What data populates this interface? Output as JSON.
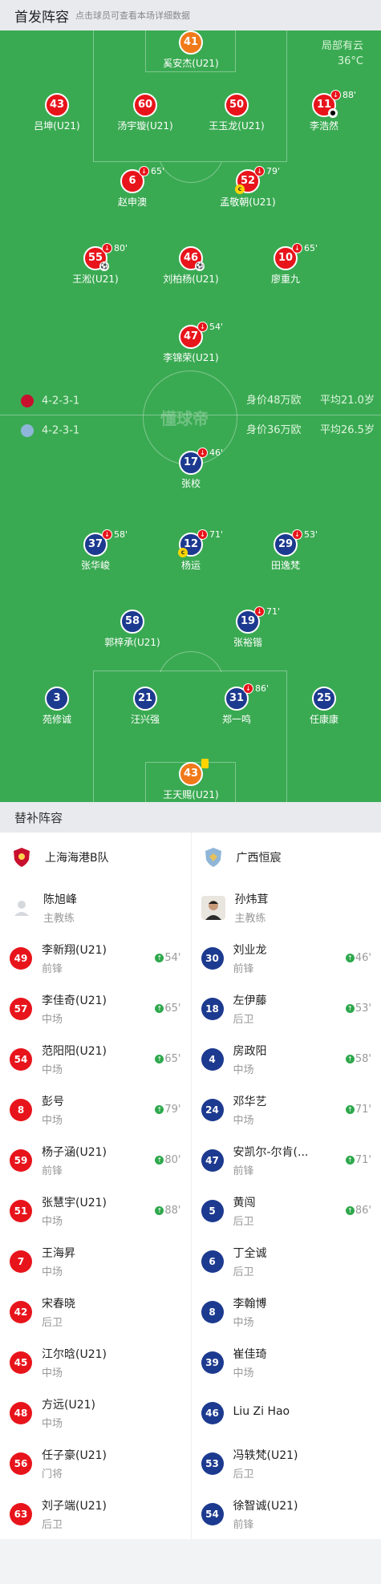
{
  "header": {
    "title": "首发阵容",
    "hint": "点击球员可查看本场详细数据"
  },
  "weather": {
    "line1": "局部有云",
    "line2": "36°C"
  },
  "watermark": "懂球帝",
  "home": {
    "formation": "4-2-3-1",
    "value": "身价48万欧",
    "avg_age": "平均21.0岁",
    "players": [
      {
        "num": "41",
        "name": "奚安杰(U21)",
        "kit": "gk"
      },
      {
        "num": "43",
        "name": "吕坤(U21)",
        "kit": "red"
      },
      {
        "num": "60",
        "name": "汤宇璇(U21)",
        "kit": "red"
      },
      {
        "num": "50",
        "name": "王玉龙(U21)",
        "kit": "red"
      },
      {
        "num": "11",
        "name": "李浩然",
        "kit": "red",
        "sub": "88'"
      },
      {
        "num": "6",
        "name": "赵申澳",
        "kit": "red",
        "sub": "65'"
      },
      {
        "num": "52",
        "name": "孟敬朝(U21)",
        "kit": "red",
        "sub": "79'"
      },
      {
        "num": "55",
        "name": "王淞(U21)",
        "kit": "red",
        "sub": "80'"
      },
      {
        "num": "46",
        "name": "刘柏杨(U21)",
        "kit": "red"
      },
      {
        "num": "10",
        "name": "廖重九",
        "kit": "red",
        "sub": "65'"
      },
      {
        "num": "47",
        "name": "李锦荣(U21)",
        "kit": "red",
        "sub": "54'"
      }
    ]
  },
  "away": {
    "formation": "4-2-3-1",
    "value": "身价36万欧",
    "avg_age": "平均26.5岁",
    "players": [
      {
        "num": "17",
        "name": "张校",
        "kit": "blue",
        "sub": "46'"
      },
      {
        "num": "37",
        "name": "张华峻",
        "kit": "blue",
        "sub": "58'"
      },
      {
        "num": "12",
        "name": "杨运",
        "kit": "blue",
        "sub": "71'"
      },
      {
        "num": "29",
        "name": "田逸梵",
        "kit": "blue",
        "sub": "53'"
      },
      {
        "num": "58",
        "name": "郭梓承(U21)",
        "kit": "blue"
      },
      {
        "num": "19",
        "name": "张裕锴",
        "kit": "blue",
        "sub": "71'"
      },
      {
        "num": "3",
        "name": "苑修诚",
        "kit": "blue"
      },
      {
        "num": "21",
        "name": "汪兴强",
        "kit": "blue"
      },
      {
        "num": "31",
        "name": "郑一鸣",
        "kit": "blue",
        "sub": "86'"
      },
      {
        "num": "25",
        "name": "任康康",
        "kit": "blue"
      },
      {
        "num": "43",
        "name": "王天赐(U21)",
        "kit": "gk"
      }
    ]
  },
  "subs": {
    "title": "替补阵容",
    "home_team": "上海海港B队",
    "away_team": "广西恒宸",
    "home_coach": {
      "name": "陈旭峰",
      "role": "主教练"
    },
    "away_coach": {
      "name": "孙炜茸",
      "role": "主教练"
    },
    "home": [
      {
        "num": "49",
        "name": "李新翔(U21)",
        "pos": "前锋",
        "time": "54'"
      },
      {
        "num": "57",
        "name": "李佳奇(U21)",
        "pos": "中场",
        "time": "65'"
      },
      {
        "num": "54",
        "name": "范阳阳(U21)",
        "pos": "中场",
        "time": "65'"
      },
      {
        "num": "8",
        "name": "彭号",
        "pos": "中场",
        "time": "79'"
      },
      {
        "num": "59",
        "name": "杨子涵(U21)",
        "pos": "前锋",
        "time": "80'"
      },
      {
        "num": "51",
        "name": "张慧宇(U21)",
        "pos": "中场",
        "time": "88'"
      },
      {
        "num": "7",
        "name": "王海昇",
        "pos": "中场"
      },
      {
        "num": "42",
        "name": "宋春晓",
        "pos": "后卫"
      },
      {
        "num": "45",
        "name": "江尔晗(U21)",
        "pos": "中场"
      },
      {
        "num": "48",
        "name": "方远(U21)",
        "pos": "中场"
      },
      {
        "num": "56",
        "name": "任子豪(U21)",
        "pos": "门将"
      },
      {
        "num": "63",
        "name": "刘子端(U21)",
        "pos": "后卫"
      }
    ],
    "away": [
      {
        "num": "30",
        "name": "刘业龙",
        "pos": "前锋",
        "time": "46'"
      },
      {
        "num": "18",
        "name": "左伊藤",
        "pos": "后卫",
        "time": "53'"
      },
      {
        "num": "4",
        "name": "房政阳",
        "pos": "中场",
        "time": "58'"
      },
      {
        "num": "24",
        "name": "邓华艺",
        "pos": "中场",
        "time": "71'"
      },
      {
        "num": "47",
        "name": "安凯尔-尔肯(...",
        "pos": "前锋",
        "time": "71'"
      },
      {
        "num": "5",
        "name": "黄闯",
        "pos": "后卫",
        "time": "86'"
      },
      {
        "num": "6",
        "name": "丁全诚",
        "pos": "后卫"
      },
      {
        "num": "8",
        "name": "李翰博",
        "pos": "中场"
      },
      {
        "num": "39",
        "name": "崔佳琦",
        "pos": "中场"
      },
      {
        "num": "46",
        "name": "Liu Zi Hao",
        "pos": ""
      },
      {
        "num": "53",
        "name": "冯轶梵(U21)",
        "pos": "后卫"
      },
      {
        "num": "54",
        "name": "徐智诚(U21)",
        "pos": "前锋"
      }
    ]
  },
  "colors": {
    "home": "#e8141b",
    "away": "#1c3a8f",
    "gk": "#f07a1a",
    "pitch": "#3aaa52"
  }
}
